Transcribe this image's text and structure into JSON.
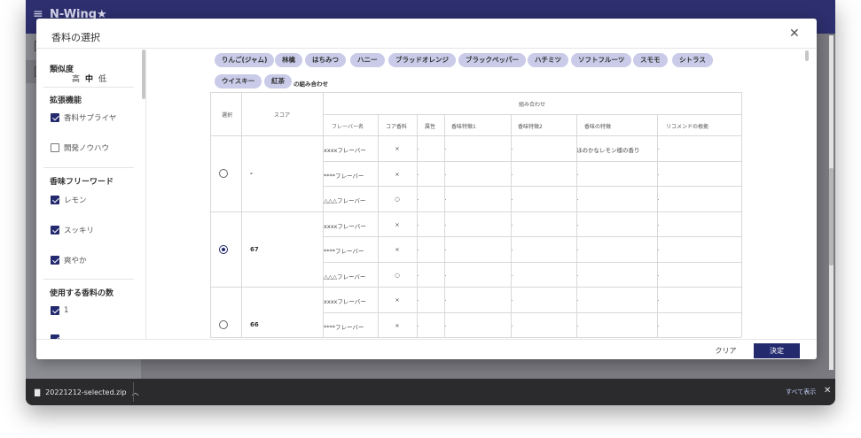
{
  "app": {
    "title": "N-Wing★"
  },
  "downloads": {
    "filename": "20221212-selected.zip",
    "show_all": "すべて表示"
  },
  "modal": {
    "title": "香料の選択",
    "filters": {
      "similarity": {
        "title": "類似度",
        "levels": [
          "高",
          "中",
          "低"
        ]
      },
      "extensions": {
        "title": "拡張機能",
        "items": [
          {
            "label": "香料サプライヤ",
            "checked": true
          },
          {
            "label": "開発ノウハウ",
            "checked": false
          }
        ]
      },
      "keywords": {
        "title": "香味フリーワード",
        "items": [
          {
            "label": "レモン",
            "checked": true
          },
          {
            "label": "スッキリ",
            "checked": true
          },
          {
            "label": "爽やか",
            "checked": true
          }
        ]
      },
      "count": {
        "title": "使用する香料の数",
        "items": [
          {
            "label": "1",
            "checked": true
          }
        ]
      }
    },
    "chips": [
      "りんご(ジャム)",
      "林檎",
      "はちみつ",
      "ハニー",
      "ブラッドオレンジ",
      "ブラックペッパー",
      "ハチミツ",
      "ソフトフルーツ",
      "スモモ",
      "シトラス",
      "ウイスキー",
      "紅茶"
    ],
    "chips_suffix": "の組み合わせ",
    "table": {
      "headers": {
        "select": "選択",
        "score": "スコア",
        "combo": "組み合わせ",
        "flavor_name": "フレーバー名",
        "core": "コア香料",
        "attr": "属性",
        "feature1": "香味特徴1",
        "feature2": "香味特徴2",
        "flavor_feature": "香味の特徴",
        "reason": "リコメンドの根拠"
      },
      "groups": [
        {
          "score": "-",
          "selected": false,
          "rows": [
            {
              "name": "xxxxフレーバー",
              "core": "×",
              "attr": "-",
              "f1": "-",
              "f2": "-",
              "feature": "ほのかなレモン様の香り",
              "reason": "-"
            },
            {
              "name": "****フレーバー",
              "core": "×",
              "attr": "-",
              "f1": "-",
              "f2": "-",
              "feature": "-",
              "reason": "-"
            },
            {
              "name": "△△△フレーバー",
              "core": "○",
              "attr": "-",
              "f1": "-",
              "f2": "-",
              "feature": "-",
              "reason": "-"
            }
          ]
        },
        {
          "score": "67",
          "selected": true,
          "rows": [
            {
              "name": "xxxxフレーバー",
              "core": "×",
              "attr": "-",
              "f1": "-",
              "f2": "-",
              "feature": "-",
              "reason": "-"
            },
            {
              "name": "****フレーバー",
              "core": "×",
              "attr": "-",
              "f1": "-",
              "f2": "-",
              "feature": "-",
              "reason": "-"
            },
            {
              "name": "△△△フレーバー",
              "core": "○",
              "attr": "-",
              "f1": "-",
              "f2": "-",
              "feature": "-",
              "reason": "-"
            }
          ]
        },
        {
          "score": "66",
          "selected": false,
          "rows": [
            {
              "name": "xxxxフレーバー",
              "core": "×",
              "attr": "-",
              "f1": "-",
              "f2": "-",
              "feature": "-",
              "reason": "-"
            },
            {
              "name": "****フレーバー",
              "core": "×",
              "attr": "-",
              "f1": "-",
              "f2": "-",
              "feature": "-",
              "reason": "-"
            }
          ]
        }
      ]
    },
    "buttons": {
      "clear": "クリア",
      "confirm": "決定"
    }
  },
  "colors": {
    "primary": "#232a6e",
    "chip": "#c9cbe8",
    "appbar": "#2d2f6e"
  }
}
